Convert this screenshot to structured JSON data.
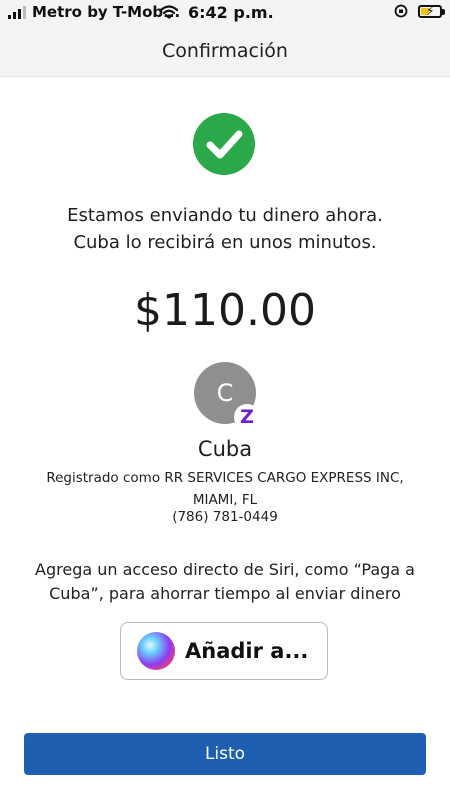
{
  "status_bar": {
    "carrier": "Metro by T-Mob...",
    "time": "6:42 p.m."
  },
  "nav": {
    "title": "Confirmación"
  },
  "confirmation": {
    "line1": "Estamos enviando tu dinero ahora.",
    "line2": "Cuba lo recibirá en unos minutos.",
    "amount": "$110.00"
  },
  "recipient": {
    "initial": "C",
    "name": "Cuba",
    "registered_line1": "Registrado como RR SERVICES CARGO EXPRESS INC,",
    "registered_line2": "MIAMI, FL",
    "phone": "(786) 781-0449"
  },
  "siri": {
    "text": "Agrega un acceso directo de Siri, como “Paga a Cuba”, para ahorrar tiempo al enviar dinero",
    "button_label": "Añadir a..."
  },
  "actions": {
    "done_label": "Listo"
  },
  "colors": {
    "success": "#2aa84a",
    "primary": "#1f5fb1",
    "zelle": "#6d1ed4"
  }
}
